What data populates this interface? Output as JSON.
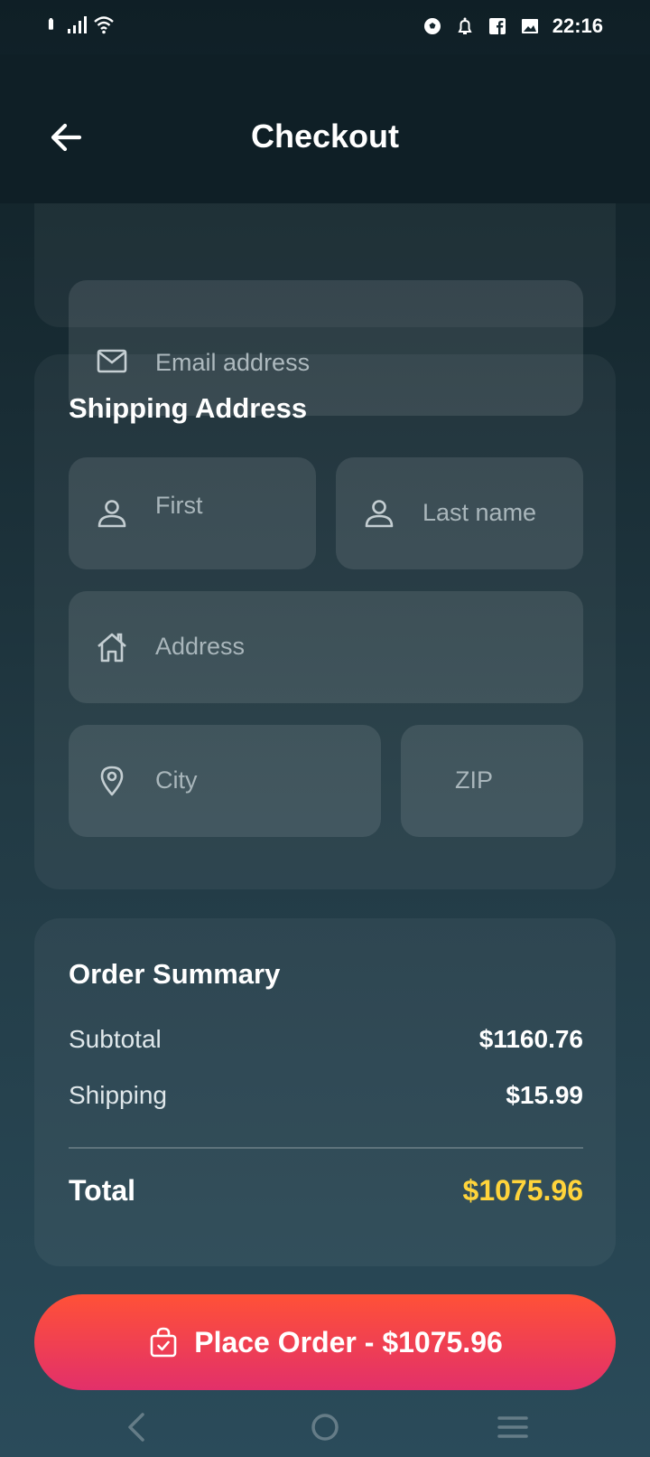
{
  "status_bar": {
    "time": "22:16"
  },
  "header": {
    "title": "Checkout"
  },
  "contact": {
    "email_placeholder": "Email address"
  },
  "shipping": {
    "title": "Shipping Address",
    "first_placeholder": "First",
    "last_placeholder": "Last name",
    "address_placeholder": "Address",
    "city_placeholder": "City",
    "zip_placeholder": "ZIP"
  },
  "summary": {
    "title": "Order Summary",
    "subtotal_label": "Subtotal",
    "subtotal_value": "$1160.76",
    "shipping_label": "Shipping",
    "shipping_value": "$15.99",
    "total_label": "Total",
    "total_value": "$1075.96"
  },
  "action": {
    "place_order_label": "Place Order - $1075.96"
  },
  "colors": {
    "accent_total": "#ffd43b",
    "button_top": "#ff5137",
    "button_bottom": "#e2306a"
  },
  "icons": [
    "battery-icon",
    "signal-icon",
    "wifi-icon",
    "soccer-icon",
    "bell-icon",
    "facebook-icon",
    "gallery-icon",
    "back-arrow-icon",
    "mail-icon",
    "user-icon",
    "home-icon",
    "location-pin-icon",
    "shopping-bag-icon",
    "nav-back-icon",
    "nav-home-icon",
    "nav-menu-icon"
  ]
}
